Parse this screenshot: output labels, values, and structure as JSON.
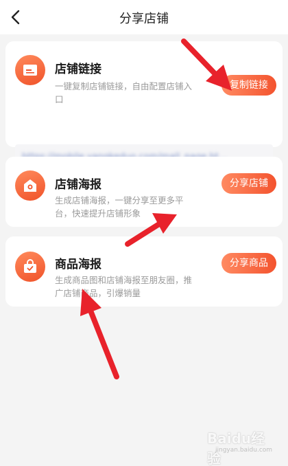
{
  "nav": {
    "title": "分享店铺"
  },
  "cards": [
    {
      "title": "店铺链接",
      "desc": "一键复制店铺链接，自由配置店铺入口",
      "button": "复制链接",
      "url": "https://mobile.yangkeduo.com/mall_page.ht..."
    },
    {
      "title": "店铺海报",
      "desc": "生成店铺海报，一键分享至更多平台，快速提升店铺形象",
      "button": "分享店铺"
    },
    {
      "title": "商品海报",
      "desc": "生成商品图和店铺海报至朋友圈，推广店铺商品，引爆销量",
      "button": "分享商品"
    }
  ],
  "watermark": {
    "brand": "Baidu经验",
    "sub": "jingyan.baidu.com"
  },
  "colors": {
    "accent": "#f3532e",
    "arrow": "#e8222b"
  }
}
